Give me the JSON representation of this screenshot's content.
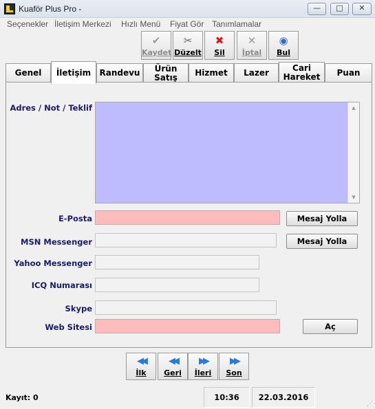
{
  "window": {
    "title": "Kuaför Plus Pro -",
    "buttons": {
      "minimize": "—",
      "maximize": "□",
      "close": "✕"
    }
  },
  "menu": [
    "Seçenekler",
    "İletişim Merkezi",
    "Hızlı Menü",
    "Fiyat Gör",
    "Tanımlamalar"
  ],
  "toolbar": [
    {
      "label": "Kaydet",
      "icon": "check-icon",
      "glyph": "✔",
      "color": "#9a9a9a",
      "enabled": false
    },
    {
      "label": "Düzelt",
      "icon": "tools-icon",
      "glyph": "✂",
      "color": "#666666",
      "enabled": true
    },
    {
      "label": "Sil",
      "icon": "delete-icon",
      "glyph": "✖",
      "color": "#d81818",
      "enabled": true
    },
    {
      "label": "İptal",
      "icon": "cancel-icon",
      "glyph": "✕",
      "color": "#9a9a9a",
      "enabled": false
    },
    {
      "label": "Bul",
      "icon": "eye-icon",
      "glyph": "◉",
      "color": "#2a6cc8",
      "enabled": true
    }
  ],
  "tabs": [
    "Genel",
    "İletişim",
    "Randevu",
    "Ürün Satış",
    "Hizmet",
    "Lazer",
    "Cari Hareket",
    "Puan"
  ],
  "active_tab": "İletişim",
  "form": {
    "address_label": "Adres / Not / Teklif",
    "address_value": "",
    "email_label": "E-Posta",
    "email_value": "",
    "msn_label": "MSN Messenger",
    "msn_value": "",
    "yahoo_label": "Yahoo Messenger",
    "yahoo_value": "",
    "icq_label": "ICQ Numarası",
    "icq_value": "",
    "skype_label": "Skype",
    "skype_value": "",
    "web_label": "Web Sitesi",
    "web_value": "",
    "send_email_button": "Mesaj Yolla",
    "send_msn_button": "Mesaj Yolla",
    "open_web_button": "Aç"
  },
  "navigation": [
    {
      "label": "İlk",
      "icon": "first-icon",
      "glyph": "◀◀"
    },
    {
      "label": "Geri",
      "icon": "previous-icon",
      "glyph": "◀◀"
    },
    {
      "label": "İleri",
      "icon": "next-icon",
      "glyph": "▶▶"
    },
    {
      "label": "Son",
      "icon": "last-icon",
      "glyph": "▶▶"
    }
  ],
  "status": {
    "record_count": "Kayıt: 0",
    "time": "10:36",
    "date": "22.03.2016"
  },
  "colors": {
    "address_bg": "#bebcff",
    "highlight_field": "#ffbcbc",
    "label_text": "#1a1a6a"
  }
}
